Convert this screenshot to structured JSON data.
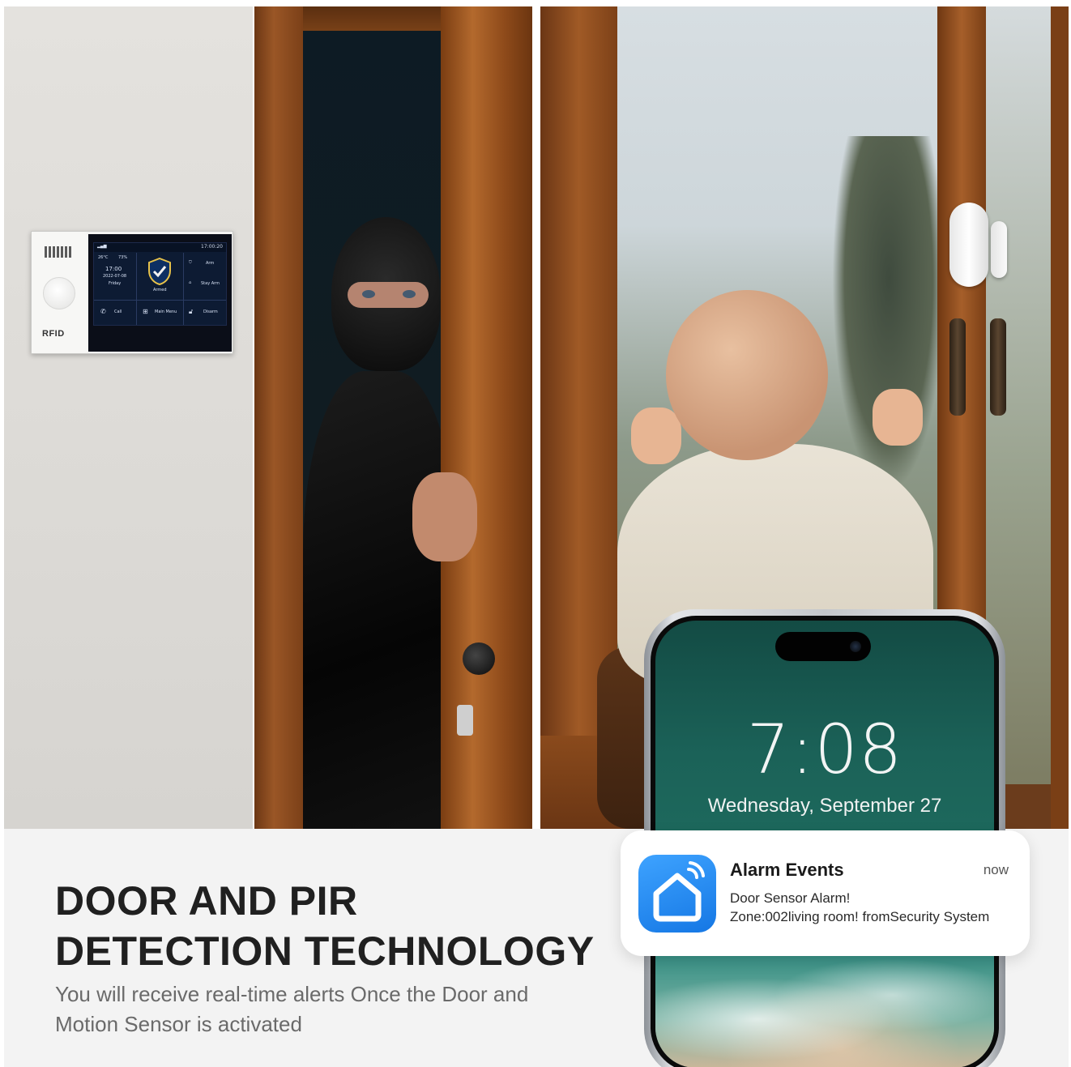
{
  "device": {
    "brand_label": "RFID",
    "screen": {
      "time_top": "17:00:20",
      "temperature": "26°C",
      "humidity": "73%",
      "clock": "17:00",
      "date": "2022-07-08",
      "weekday": "Friday",
      "status": "Armed",
      "arm_label": "Arm",
      "stay_arm_label": "Stay Arm",
      "call_label": "Call",
      "main_menu_label": "Main Menu",
      "disarm_label": "Disarm"
    }
  },
  "phone": {
    "lock_time": "7:08",
    "lock_date": "Wednesday, September 27"
  },
  "notification": {
    "title": "Alarm Events",
    "time": "now",
    "line1": "Door Sensor Alarm!",
    "line2": "Zone:002living room! fromSecurity System",
    "icon": "smart-home-icon"
  },
  "banner": {
    "headline_line1": "DOOR AND PIR",
    "headline_line2": "DETECTION TECHNOLOGY",
    "subtext": "You will receive real-time alerts Once the Door and Motion Sensor is activated"
  },
  "colors": {
    "accent_blue": "#1E88F5",
    "headline": "#202020",
    "subtext": "#6A6A6A"
  }
}
